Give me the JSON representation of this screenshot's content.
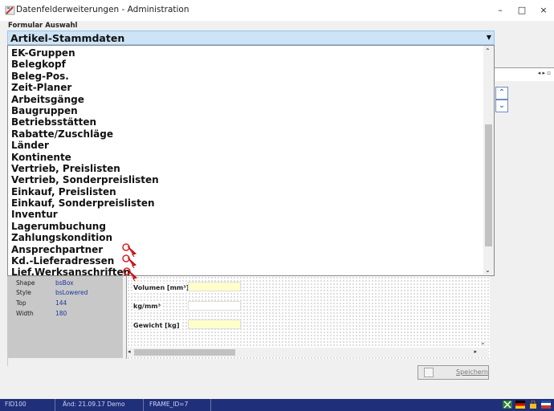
{
  "window": {
    "title": "Datenfelderweiterungen - Administration",
    "buttons": {
      "minimize": "–",
      "maximize": "□",
      "close": "×"
    }
  },
  "formular": {
    "label": "Formular Auswahl",
    "selected": "Artikel-Stammdaten",
    "items": [
      "EK-Gruppen",
      "Belegkopf",
      "Beleg-Pos.",
      "Zeit-Planer",
      "Arbeitsgänge",
      "Baugruppen",
      "Betriebsstätten",
      "Rabatte/Zuschläge",
      "Länder",
      "Kontinente",
      "Vertrieb, Preislisten",
      "Vertrieb, Sonderpreislisten",
      "Einkauf, Preislisten",
      "Einkauf, Sonderpreislisten",
      "Inventur",
      "Lagerumbuchung",
      "Zahlungskondition",
      "Ansprechpartner",
      "Kd.-Lieferadressen",
      "Lief.Werksanschriften"
    ]
  },
  "properties": {
    "rows": [
      {
        "key": "Shape",
        "value": "bsBox"
      },
      {
        "key": "Style",
        "value": "bsLowered"
      },
      {
        "key": "Top",
        "value": "144"
      },
      {
        "key": "Width",
        "value": "180"
      }
    ]
  },
  "designer": {
    "fields": [
      {
        "label": "Volumen [mm³]",
        "color": "#ffffcc"
      },
      {
        "label": "kg/mm³",
        "color": "#ffffff"
      },
      {
        "label": "Gewicht [kg]",
        "color": "#ffffcc"
      }
    ]
  },
  "save_button": {
    "label": "Speichern"
  },
  "statusbar": {
    "id": "FID100",
    "changed": "Änd: 21.09.17 Demo",
    "frame": "FRAME_ID=7"
  },
  "icons": {
    "up": "▲",
    "down": "▼",
    "chevron_up": "⌃",
    "chevron_down": "⌄",
    "nav": "◂ ▸ ▫"
  }
}
